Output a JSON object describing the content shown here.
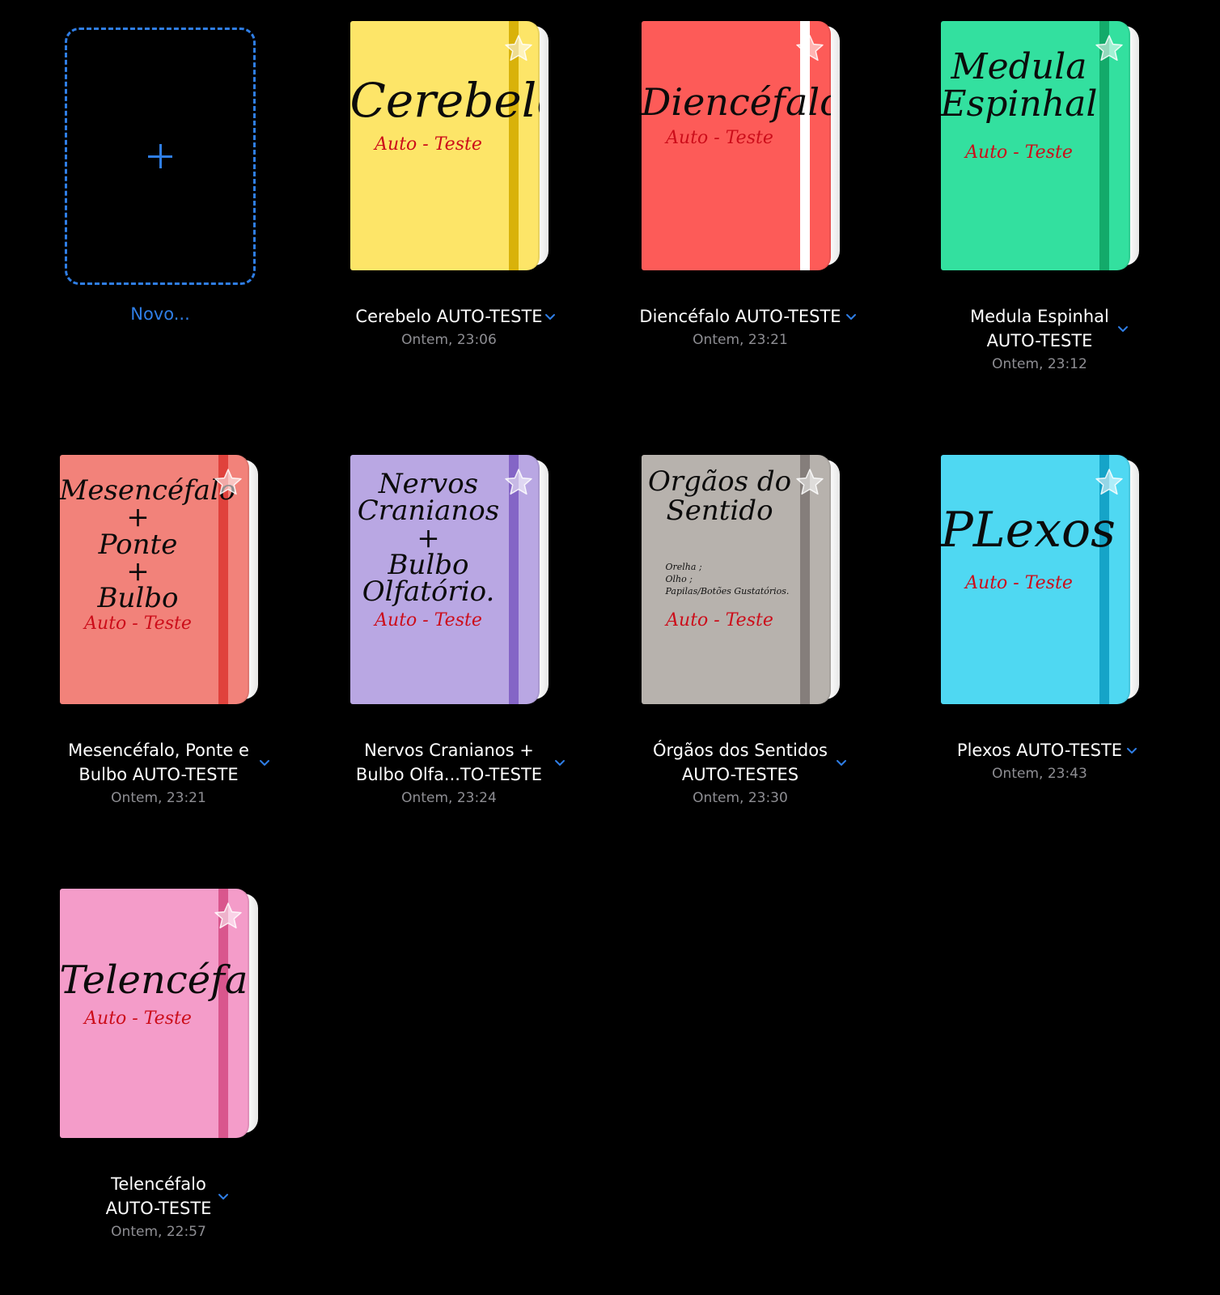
{
  "new_tile": {
    "label": "Novo..."
  },
  "notebooks": [
    {
      "name": "Cerebelo AUTO-TESTE",
      "date": "Ontem, 23:06",
      "cover_title": "Cerebelo",
      "cover_subtitle": "Auto - Teste",
      "cover_note": "",
      "cover_color": "#fde568",
      "band_color": "#d9b20a"
    },
    {
      "name": "Diencéfalo AUTO-TESTE",
      "date": "Ontem, 23:21",
      "cover_title": "Diencéfalo",
      "cover_subtitle": "Auto - Teste",
      "cover_note": "",
      "cover_color": "#fd5b58",
      "band_color": "#ffffff"
    },
    {
      "name": "Medula Espinhal\nAUTO-TESTE",
      "date": "Ontem, 23:12",
      "cover_title": "Medula\nEspinhal",
      "cover_subtitle": "Auto - Teste",
      "cover_note": "",
      "cover_color": "#33e09f",
      "band_color": "#13aa6a"
    },
    {
      "name": "Mesencéfalo, Ponte e\nBulbo AUTO-TESTE",
      "date": "Ontem, 23:21",
      "cover_title": "Mesencéfalo\n+\nPonte\n+\nBulbo",
      "cover_subtitle": "Auto - Teste",
      "cover_note": "",
      "cover_color": "#f2827a",
      "band_color": "#e0423c"
    },
    {
      "name": "Nervos Cranianos +\nBulbo Olfa...TO-TESTE",
      "date": "Ontem, 23:24",
      "cover_title": "Nervos\nCranianos\n+\nBulbo Olfatório.",
      "cover_subtitle": "Auto - Teste",
      "cover_note": "",
      "cover_color": "#b9a7e3",
      "band_color": "#8465c6"
    },
    {
      "name": "Órgãos dos Sentidos\nAUTO-TESTES",
      "date": "Ontem, 23:30",
      "cover_title": "Orgãos do\nSentido",
      "cover_subtitle": "Auto - Teste",
      "cover_note": "Orelha ;\nOlho ;\nPapilas/Botões Gustatórios.",
      "cover_color": "#b7b2ad",
      "band_color": "#857e7b"
    },
    {
      "name": "Plexos AUTO-TESTE",
      "date": "Ontem, 23:43",
      "cover_title": "PLexos",
      "cover_subtitle": "Auto - Teste",
      "cover_note": "",
      "cover_color": "#4fd8f2",
      "band_color": "#15a4c8"
    },
    {
      "name": "Telencéfalo\nAUTO-TESTE",
      "date": "Ontem, 22:57",
      "cover_title": "Telencéfalo",
      "cover_subtitle": "Auto - Teste",
      "cover_note": "",
      "cover_color": "#f49cc9",
      "band_color": "#d9568d"
    }
  ],
  "colors": {
    "background": "#000000",
    "accent": "#2f7ee6",
    "date_text": "#8e8e93",
    "name_text": "#ffffff"
  },
  "icons": {
    "new": "plus-icon",
    "favorite": "star-icon",
    "menu": "chevron-down-icon"
  }
}
